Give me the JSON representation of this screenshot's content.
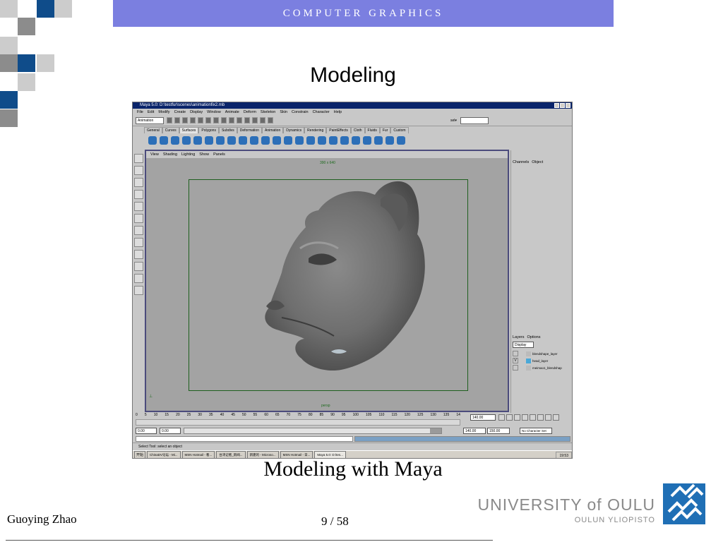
{
  "slide": {
    "banner": "COMPUTER GRAPHICS",
    "title": "Modeling",
    "caption": "Modeling with Maya",
    "author": "Guoying Zhao",
    "page_current": "9",
    "page_total": "58",
    "page_sep": " / ",
    "university_line1": "UNIVERSITY of OULU",
    "university_line2": "OULUN YLIOPISTO",
    "colors": {
      "banner": "#7b7fe0",
      "square_dark": "#0f4c8a",
      "square_grey": "#8c8c8c",
      "square_light": "#cccccc",
      "logo": "#1f6fb5"
    }
  },
  "maya": {
    "window_title": "Maya 5.0: D:\\testfur\\scenes\\animationfix2.mb",
    "menu": [
      "File",
      "Edit",
      "Modify",
      "Create",
      "Display",
      "Window",
      "Animate",
      "Deform",
      "Skeleton",
      "Skin",
      "Constrain",
      "Character",
      "Help"
    ],
    "mode": "Animation",
    "sel_label": "sel▾",
    "shelf_tabs": [
      "General",
      "Curves",
      "Surfaces",
      "Polygons",
      "Subdivs",
      "Deformation",
      "Animation",
      "Dynamics",
      "Rendering",
      "PaintEffects",
      "Cloth",
      "Fluids",
      "Fur",
      "Custom"
    ],
    "shelf_active": "Surfaces",
    "viewport_menu": [
      "View",
      "Shading",
      "Lighting",
      "Show",
      "Panels"
    ],
    "viewport_label": "390 x 640",
    "camera": "persp",
    "channel_tabs": [
      "Channels",
      "Object"
    ],
    "layer_tabs": [
      "Layers",
      "Options"
    ],
    "layer_display": "Display",
    "layers": [
      {
        "vis": "",
        "name": "blendshape_layer"
      },
      {
        "vis": "V",
        "name": "head_layer"
      },
      {
        "vis": "",
        "name": "meimao1_blendshap"
      }
    ],
    "time_ticks": [
      "0",
      "5",
      "10",
      "15",
      "20",
      "25",
      "30",
      "35",
      "40",
      "45",
      "50",
      "55",
      "60",
      "65",
      "70",
      "75",
      "80",
      "85",
      "90",
      "95",
      "100",
      "105",
      "110",
      "115",
      "120",
      "125",
      "130",
      "135",
      "14"
    ],
    "current_frame": "140.00",
    "range_start": "0.00",
    "range_start2": "0.00",
    "range_end": "140.00",
    "range_end2": "150.00",
    "character_set": "No Character Set",
    "help_line": "Select Tool: select an object",
    "taskbar": {
      "start": "开始",
      "tasks": [
        "ChinaDV论坛 - Mi...",
        "MSN Hotmail - 看...",
        "台湾记者_新闻...",
        "新建的 - Microso...",
        "MSN Hotmail - 日...",
        "Maya 5.0: D:\\tes..."
      ],
      "active_task": "Maya 5.0: D:\\tes...",
      "clock": "19:53"
    }
  }
}
